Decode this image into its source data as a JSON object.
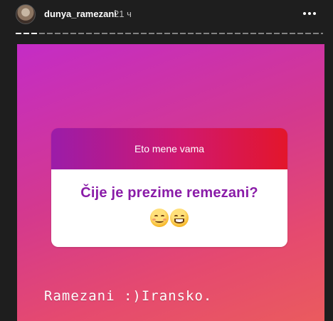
{
  "header": {
    "username": "dunya_ramezani",
    "time_ago": "21 ч",
    "more_icon": "more-horizontal-icon"
  },
  "story": {
    "question_sticker": {
      "title": "Eto mene vama",
      "question": "Čije je prezime remezani?",
      "emojis": [
        "smiling-face-with-smiling-eyes",
        "grinning-face-with-smiling-eyes"
      ]
    },
    "answer_text": "Ramezani :)Iransko."
  },
  "colors": {
    "background": "#1e1e1e",
    "gradient_start": "#c42cc6",
    "gradient_end": "#ea5b5e",
    "question_text": "#8a1ca8"
  }
}
